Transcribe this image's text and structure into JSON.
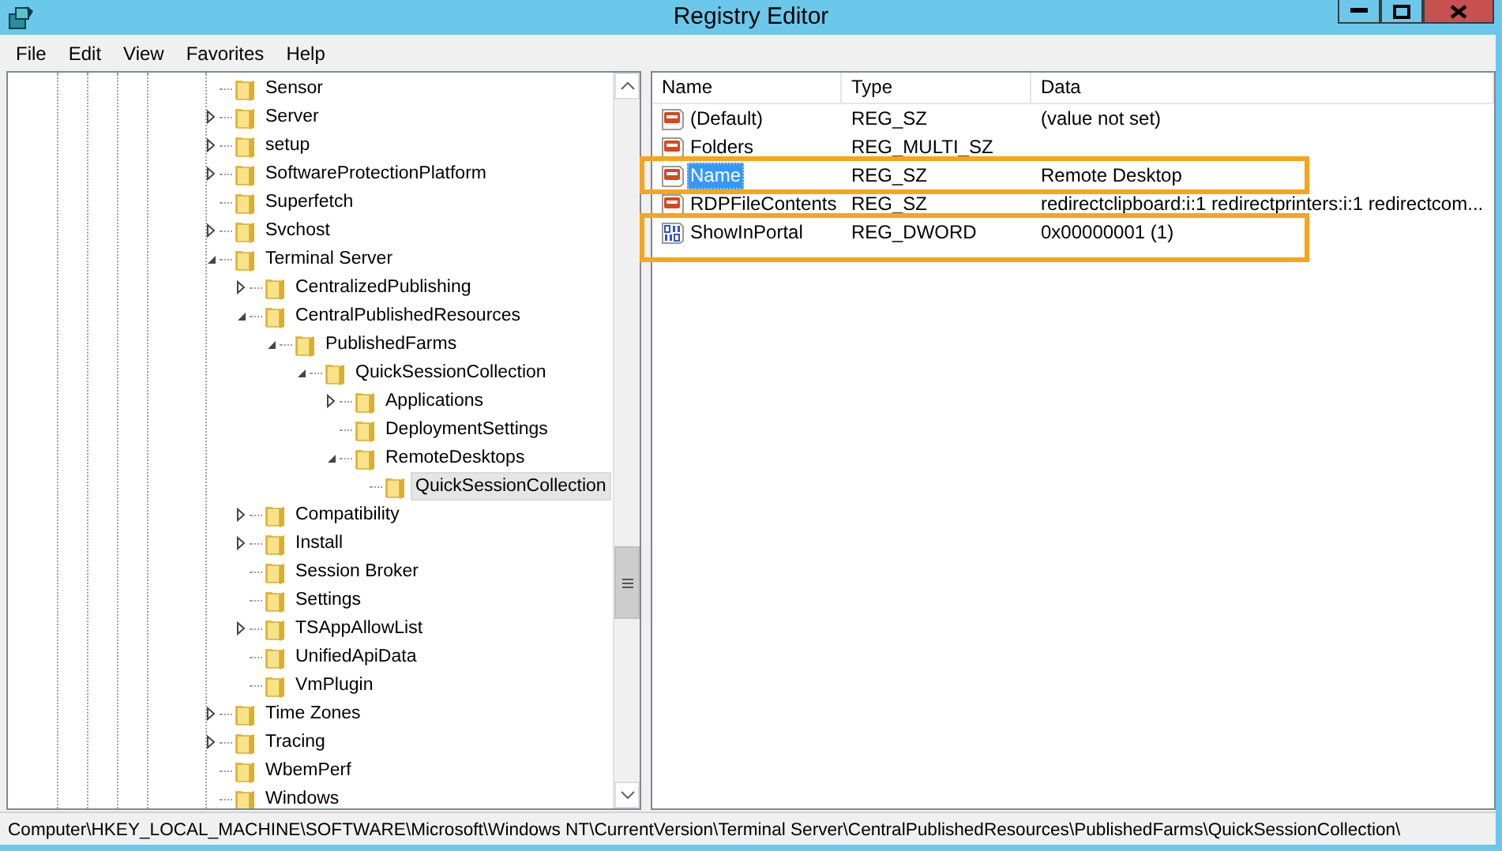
{
  "window": {
    "title": "Registry Editor"
  },
  "menu": [
    "File",
    "Edit",
    "View",
    "Favorites",
    "Help"
  ],
  "tree": [
    {
      "label": "Sensor",
      "expandable": false,
      "selected": false
    },
    {
      "label": "Server",
      "expandable": true,
      "expanded": false,
      "selected": false
    },
    {
      "label": "setup",
      "expandable": true,
      "expanded": false,
      "selected": false
    },
    {
      "label": "SoftwareProtectionPlatform",
      "expandable": true,
      "expanded": false,
      "selected": false
    },
    {
      "label": "Superfetch",
      "expandable": false,
      "selected": false
    },
    {
      "label": "Svchost",
      "expandable": true,
      "expanded": false,
      "selected": false
    },
    {
      "label": "Terminal Server",
      "expandable": true,
      "expanded": true,
      "selected": false,
      "children": [
        {
          "label": "CentralizedPublishing",
          "expandable": true,
          "expanded": false,
          "selected": false
        },
        {
          "label": "CentralPublishedResources",
          "expandable": true,
          "expanded": true,
          "selected": false,
          "children": [
            {
              "label": "PublishedFarms",
              "expandable": true,
              "expanded": true,
              "selected": false,
              "children": [
                {
                  "label": "QuickSessionCollection",
                  "expandable": true,
                  "expanded": true,
                  "selected": false,
                  "children": [
                    {
                      "label": "Applications",
                      "expandable": true,
                      "expanded": false,
                      "selected": false
                    },
                    {
                      "label": "DeploymentSettings",
                      "expandable": false,
                      "selected": false
                    },
                    {
                      "label": "RemoteDesktops",
                      "expandable": true,
                      "expanded": true,
                      "selected": false,
                      "children": [
                        {
                          "label": "QuickSessionCollection",
                          "expandable": false,
                          "selected": true
                        }
                      ]
                    }
                  ]
                }
              ]
            }
          ]
        },
        {
          "label": "Compatibility",
          "expandable": true,
          "expanded": false,
          "selected": false
        },
        {
          "label": "Install",
          "expandable": true,
          "expanded": false,
          "selected": false
        },
        {
          "label": "Session Broker",
          "expandable": false,
          "selected": false
        },
        {
          "label": "Settings",
          "expandable": false,
          "selected": false
        },
        {
          "label": "TSAppAllowList",
          "expandable": true,
          "expanded": false,
          "selected": false
        },
        {
          "label": "UnifiedApiData",
          "expandable": false,
          "selected": false
        },
        {
          "label": "VmPlugin",
          "expandable": false,
          "selected": false
        }
      ]
    },
    {
      "label": "Time Zones",
      "expandable": true,
      "expanded": false,
      "selected": false
    },
    {
      "label": "Tracing",
      "expandable": true,
      "expanded": false,
      "selected": false
    },
    {
      "label": "WbemPerf",
      "expandable": false,
      "selected": false
    },
    {
      "label": "Windows",
      "expandable": false,
      "selected": false
    }
  ],
  "table": {
    "columns": [
      "Name",
      "Type",
      "Data"
    ],
    "rows": [
      {
        "kind": "string",
        "name": "(Default)",
        "type": "REG_SZ",
        "data": "(value not set)",
        "selected": false,
        "highlighted": false
      },
      {
        "kind": "string",
        "name": "Folders",
        "type": "REG_MULTI_SZ",
        "data": "",
        "selected": false,
        "highlighted": false
      },
      {
        "kind": "string",
        "name": "Name",
        "type": "REG_SZ",
        "data": "Remote Desktop",
        "selected": true,
        "highlighted": true
      },
      {
        "kind": "string",
        "name": "RDPFileContents",
        "type": "REG_SZ",
        "data": "redirectclipboard:i:1 redirectprinters:i:1 redirectcom...",
        "selected": false,
        "highlighted": false
      },
      {
        "kind": "binary",
        "name": "ShowInPortal",
        "type": "REG_DWORD",
        "data": "0x00000001 (1)",
        "selected": false,
        "highlighted": true
      }
    ]
  },
  "status_bar": "Computer\\HKEY_LOCAL_MACHINE\\SOFTWARE\\Microsoft\\Windows NT\\CurrentVersion\\Terminal Server\\CentralPublishedResources\\PublishedFarms\\QuickSessionCollection\\"
}
